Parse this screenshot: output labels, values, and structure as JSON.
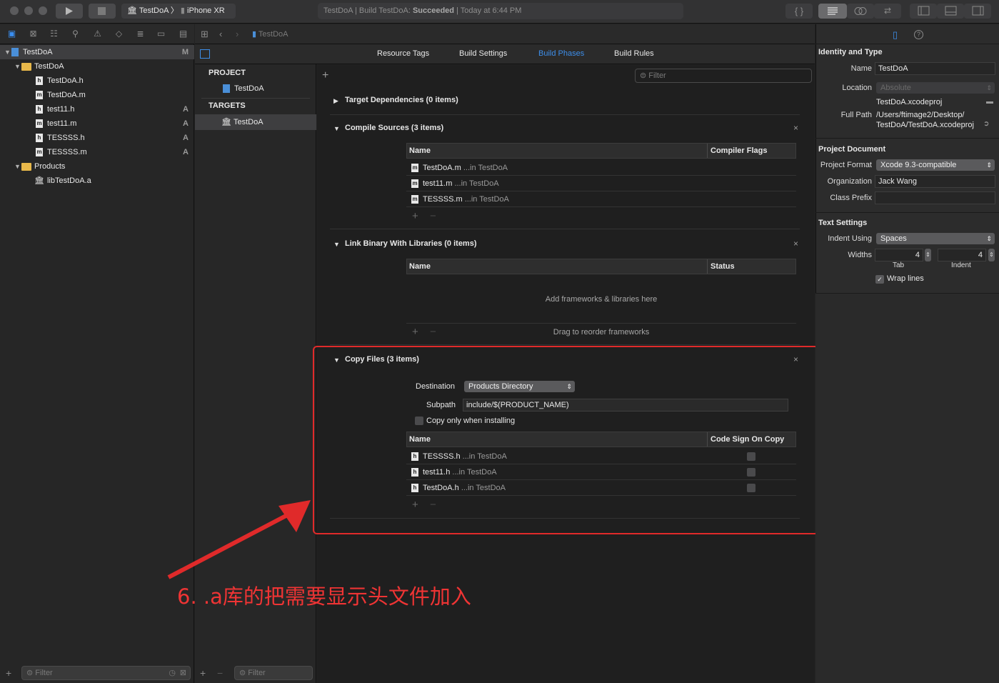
{
  "toolbar": {
    "scheme_target": "TestDoA",
    "scheme_device": "iPhone XR",
    "activity_prefix": "TestDoA | Build TestDoA: ",
    "activity_status": "Succeeded",
    "activity_time": " | Today at 6:44 PM"
  },
  "jump_bar": {
    "file": "TestDoA"
  },
  "navigator": {
    "items": [
      {
        "label": "TestDoA",
        "badge": "M"
      },
      {
        "label": "TestDoA",
        "badge": ""
      },
      {
        "label": "TestDoA.h",
        "badge": ""
      },
      {
        "label": "TestDoA.m",
        "badge": ""
      },
      {
        "label": "test11.h",
        "badge": "A"
      },
      {
        "label": "test11.m",
        "badge": "A"
      },
      {
        "label": "TESSSS.h",
        "badge": "A"
      },
      {
        "label": "TESSSS.m",
        "badge": "A"
      },
      {
        "label": "Products",
        "badge": ""
      },
      {
        "label": "libTestDoA.a",
        "badge": ""
      }
    ],
    "filter_placeholder": "Filter"
  },
  "project_list": {
    "project_header": "PROJECT",
    "project_item": "TestDoA",
    "targets_header": "TARGETS",
    "target_item": "TestDoA",
    "filter_placeholder": "Filter"
  },
  "tabs": [
    "Resource Tags",
    "Build Settings",
    "Build Phases",
    "Build Rules"
  ],
  "editor": {
    "filter_placeholder": "Filter",
    "phases": {
      "target_deps": {
        "title": "Target Dependencies (0 items)"
      },
      "compile": {
        "title": "Compile Sources (3 items)",
        "col_name": "Name",
        "col_flags": "Compiler Flags",
        "rows": [
          {
            "name": "TestDoA.m",
            "loc": "...in TestDoA"
          },
          {
            "name": "test11.m",
            "loc": "...in TestDoA"
          },
          {
            "name": "TESSSS.m",
            "loc": "...in TestDoA"
          }
        ]
      },
      "link": {
        "title": "Link Binary With Libraries (0 items)",
        "col_name": "Name",
        "col_status": "Status",
        "empty_text": "Add frameworks & libraries here",
        "reorder_text": "Drag to reorder frameworks"
      },
      "copy": {
        "title": "Copy Files (3 items)",
        "destination_label": "Destination",
        "destination_value": "Products Directory",
        "subpath_label": "Subpath",
        "subpath_value": "include/$(PRODUCT_NAME)",
        "copy_only_label": "Copy only when installing",
        "col_name": "Name",
        "col_sign": "Code Sign On Copy",
        "rows": [
          {
            "name": "TESSSS.h",
            "loc": "...in TestDoA"
          },
          {
            "name": "test11.h",
            "loc": "...in TestDoA"
          },
          {
            "name": "TestDoA.h",
            "loc": "...in TestDoA"
          }
        ]
      }
    }
  },
  "annotation": "6. .a库的把需要显示头文件加入",
  "annotation_color": "#ef3434",
  "inspector": {
    "identity_title": "Identity and Type",
    "name_label": "Name",
    "name_value": "TestDoA",
    "location_label": "Location",
    "location_value": "Absolute",
    "location_file": "TestDoA.xcodeproj",
    "fullpath_label": "Full Path",
    "fullpath_line1": "/Users/ftimage2/Desktop/",
    "fullpath_line2": "TestDoA/TestDoA.xcodeproj",
    "project_doc_title": "Project Document",
    "format_label": "Project Format",
    "format_value": "Xcode 9.3-compatible",
    "org_label": "Organization",
    "org_value": "Jack Wang",
    "prefix_label": "Class Prefix",
    "prefix_value": "",
    "text_settings_title": "Text Settings",
    "indent_label": "Indent Using",
    "indent_value": "Spaces",
    "widths_label": "Widths",
    "tab_width": "4",
    "indent_width": "4",
    "tab_caption": "Tab",
    "indent_caption": "Indent",
    "wrap_label": "Wrap lines"
  },
  "colors": {
    "accent": "#3d8eea",
    "annotation_box": "#e02a2a"
  }
}
